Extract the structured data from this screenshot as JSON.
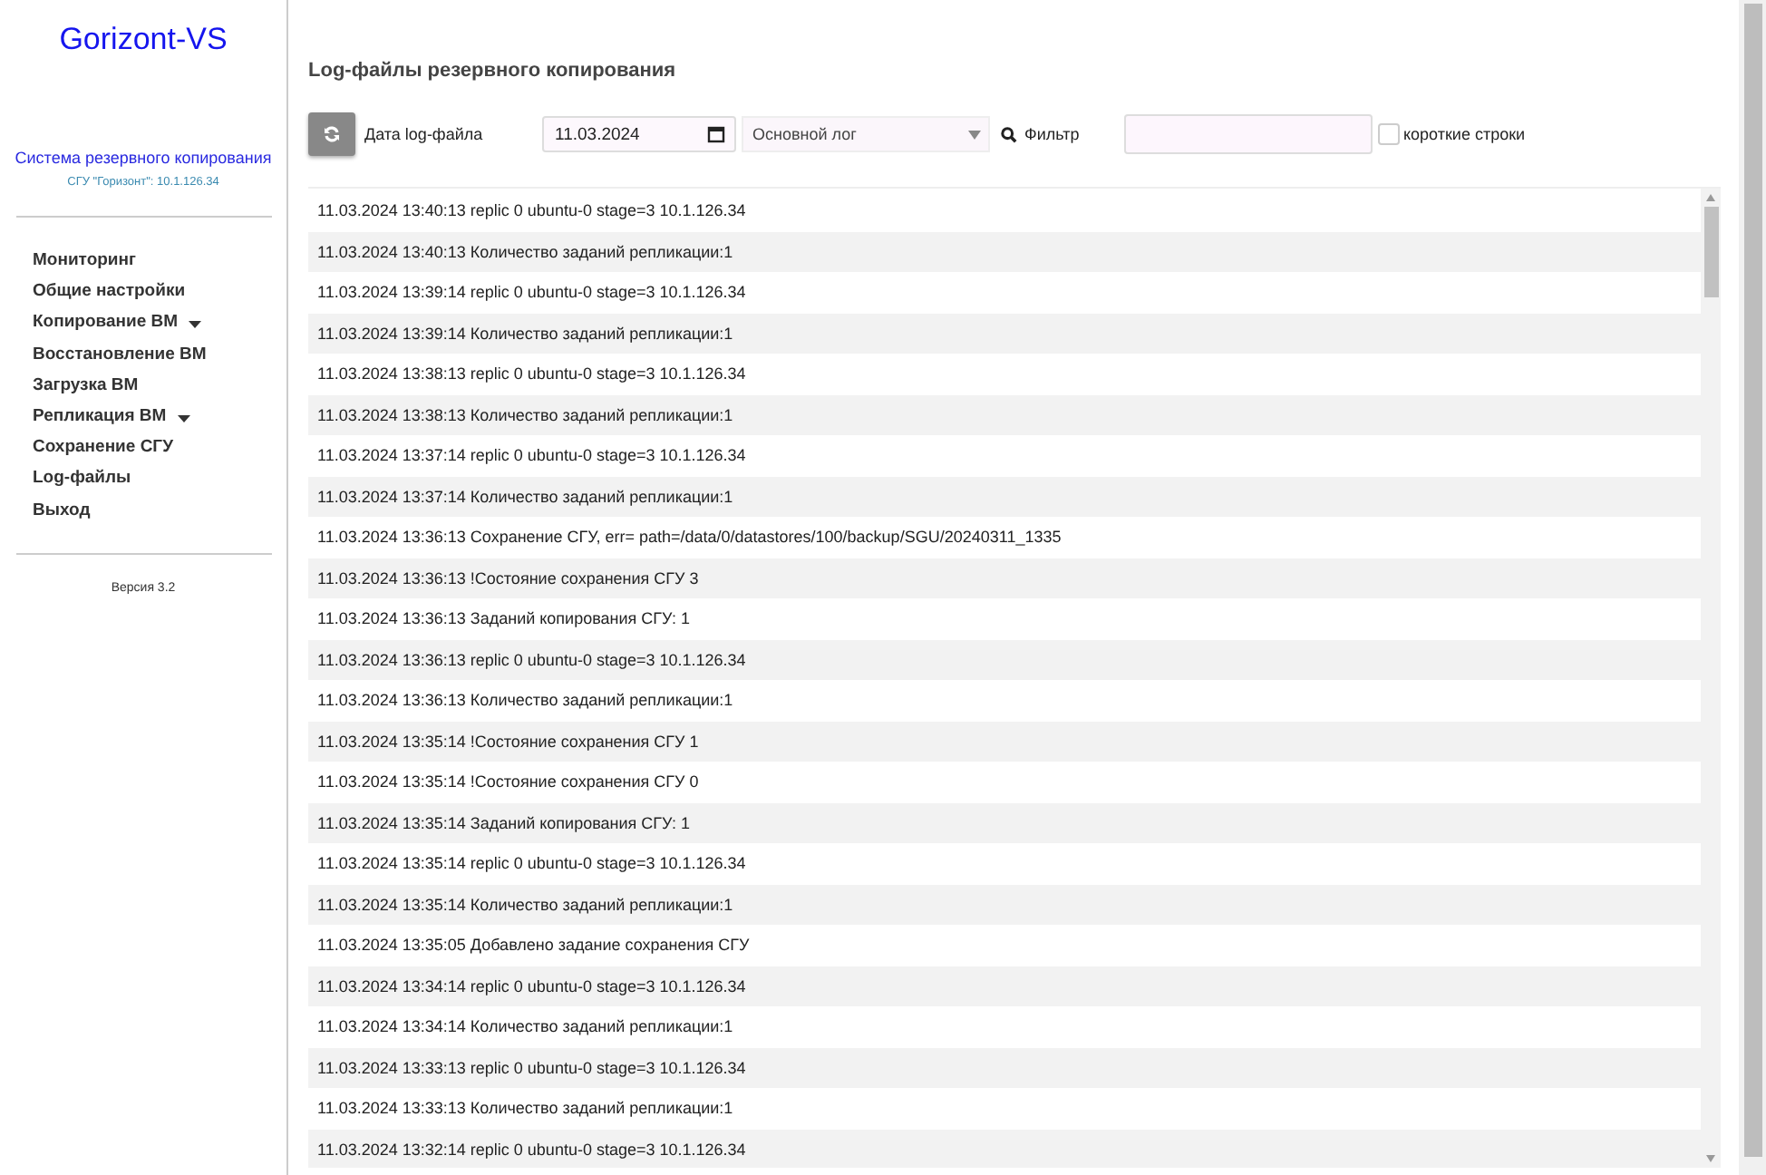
{
  "sidebar": {
    "logo": "Gorizont-VS",
    "subtitle": "Система резервного копирования",
    "server": "СГУ \"Горизонт\": 10.1.126.34",
    "menu": [
      {
        "label": "Мониторинг",
        "dropdown": false
      },
      {
        "label": "Общие настройки",
        "dropdown": false
      },
      {
        "label": "Копирование ВМ",
        "dropdown": true
      },
      {
        "label": "Восстановление ВМ",
        "dropdown": false
      },
      {
        "label": "Загрузка ВМ",
        "dropdown": false
      },
      {
        "label": "Репликация ВМ",
        "dropdown": true
      },
      {
        "label": "Сохранение СГУ",
        "dropdown": false
      },
      {
        "label": "Log-файлы",
        "dropdown": false
      },
      {
        "label": "Выход",
        "dropdown": false
      }
    ],
    "version": "Версия 3.2"
  },
  "page_title": "Log-файлы резервного копирования",
  "toolbar": {
    "date_label": "Дата log-файла",
    "date_value": "11.03.2024",
    "log_select": "Основной лог",
    "filter_label": "Фильтр",
    "short_lines": {
      "label": "короткие строки",
      "checked": false
    }
  },
  "log_lines": [
    "11.03.2024 13:40:13 replic 0 ubuntu-0 stage=3 10.1.126.34",
    "11.03.2024 13:40:13 Количество заданий репликации:1",
    "11.03.2024 13:39:14 replic 0 ubuntu-0 stage=3 10.1.126.34",
    "11.03.2024 13:39:14 Количество заданий репликации:1",
    "11.03.2024 13:38:13 replic 0 ubuntu-0 stage=3 10.1.126.34",
    "11.03.2024 13:38:13 Количество заданий репликации:1",
    "11.03.2024 13:37:14 replic 0 ubuntu-0 stage=3 10.1.126.34",
    "11.03.2024 13:37:14 Количество заданий репликации:1",
    "11.03.2024 13:36:13 Сохранение СГУ, err= path=/data/0/datastores/100/backup/SGU/20240311_1335",
    "11.03.2024 13:36:13 !Состояние сохранения СГУ 3",
    "11.03.2024 13:36:13 Заданий копирования СГУ: 1",
    "11.03.2024 13:36:13 replic 0 ubuntu-0 stage=3 10.1.126.34",
    "11.03.2024 13:36:13 Количество заданий репликации:1",
    "11.03.2024 13:35:14 !Состояние сохранения СГУ 1",
    "11.03.2024 13:35:14 !Состояние сохранения СГУ 0",
    "11.03.2024 13:35:14 Заданий копирования СГУ: 1",
    "11.03.2024 13:35:14 replic 0 ubuntu-0 stage=3 10.1.126.34",
    "11.03.2024 13:35:14 Количество заданий репликации:1",
    "11.03.2024 13:35:05 Добавлено задание сохранения СГУ",
    "11.03.2024 13:34:14 replic 0 ubuntu-0 stage=3 10.1.126.34",
    "11.03.2024 13:34:14 Количество заданий репликации:1",
    "11.03.2024 13:33:13 replic 0 ubuntu-0 stage=3 10.1.126.34",
    "11.03.2024 13:33:13 Количество заданий репликации:1",
    "11.03.2024 13:32:14 replic 0 ubuntu-0 stage=3 10.1.126.34"
  ]
}
